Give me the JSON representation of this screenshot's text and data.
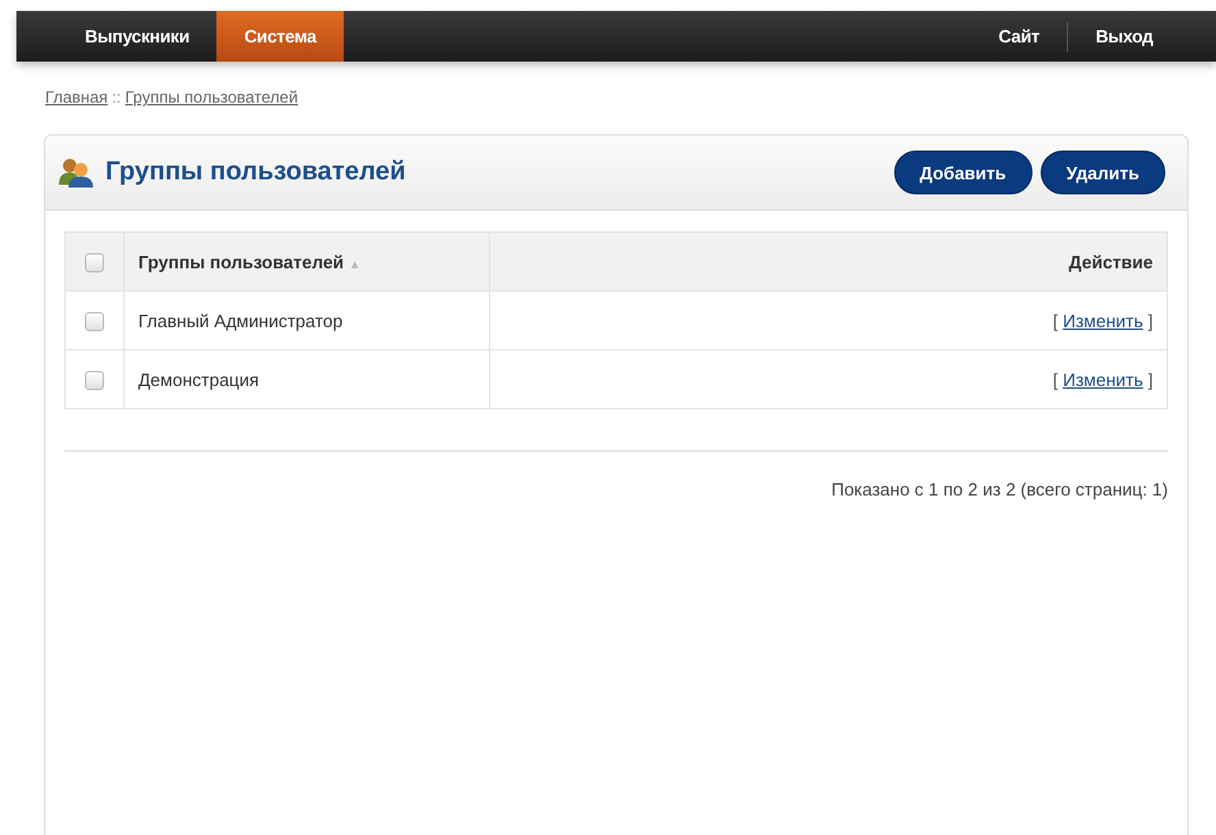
{
  "nav": {
    "left": [
      {
        "label": "Выпускники",
        "selected": false
      },
      {
        "label": "Система",
        "selected": true
      }
    ],
    "right": [
      {
        "label": "Сайт"
      },
      {
        "label": "Выход"
      }
    ]
  },
  "breadcrumb": {
    "items": [
      "Главная",
      "Группы пользователей"
    ],
    "separator": "::"
  },
  "panel": {
    "title": "Группы пользователей",
    "buttons": [
      "Добавить",
      "Удалить"
    ]
  },
  "table": {
    "header_checked": false,
    "columns": [
      {
        "label": "Группы пользователей",
        "sort": "▲"
      },
      {
        "label": "Действие"
      }
    ],
    "rows": [
      {
        "checked": false,
        "name": "Главный Администратор",
        "action": {
          "open": "[",
          "link": "Изменить",
          "close": "]"
        }
      },
      {
        "checked": false,
        "name": "Демонстрация",
        "action": {
          "open": "[",
          "link": "Изменить",
          "close": "]"
        }
      }
    ]
  },
  "pagination": "Показано с 1 по 2 из 2 (всего страниц: 1)"
}
